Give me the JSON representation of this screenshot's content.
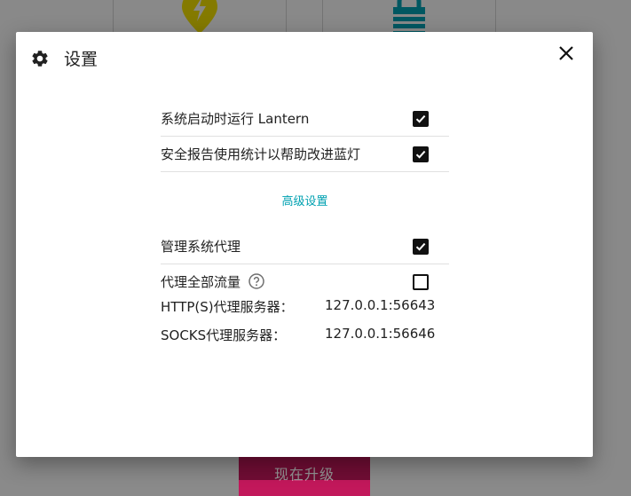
{
  "background": {
    "upgrade_button_label": "现在升级",
    "icons": [
      "location-bolt-icon",
      "lock-icon"
    ]
  },
  "dialog": {
    "title": "设置",
    "title_icon": "gear-icon",
    "close_icon": "close-icon",
    "settings": [
      {
        "label": "系统启动时运行 Lantern",
        "checked": true
      },
      {
        "label": "安全报告使用统计以帮助改进蓝灯",
        "checked": true
      }
    ],
    "advanced_link": "高级设置",
    "advanced_settings": [
      {
        "label": "管理系统代理",
        "checked": true
      },
      {
        "label": "代理全部流量",
        "checked": false,
        "help_icon": "help-icon"
      }
    ],
    "proxy_info": [
      {
        "label": "HTTP(S)代理服务器：",
        "value": "127.0.0.1:56643"
      },
      {
        "label": "SOCKS代理服务器：",
        "value": "127.0.0.1:56646"
      }
    ]
  },
  "colors": {
    "accent_link": "#00a1b1",
    "checkbox": "#111111",
    "upgrade_button": "#c2185b",
    "location_icon": "#e3d300",
    "lock_icon": "#0096a8"
  }
}
